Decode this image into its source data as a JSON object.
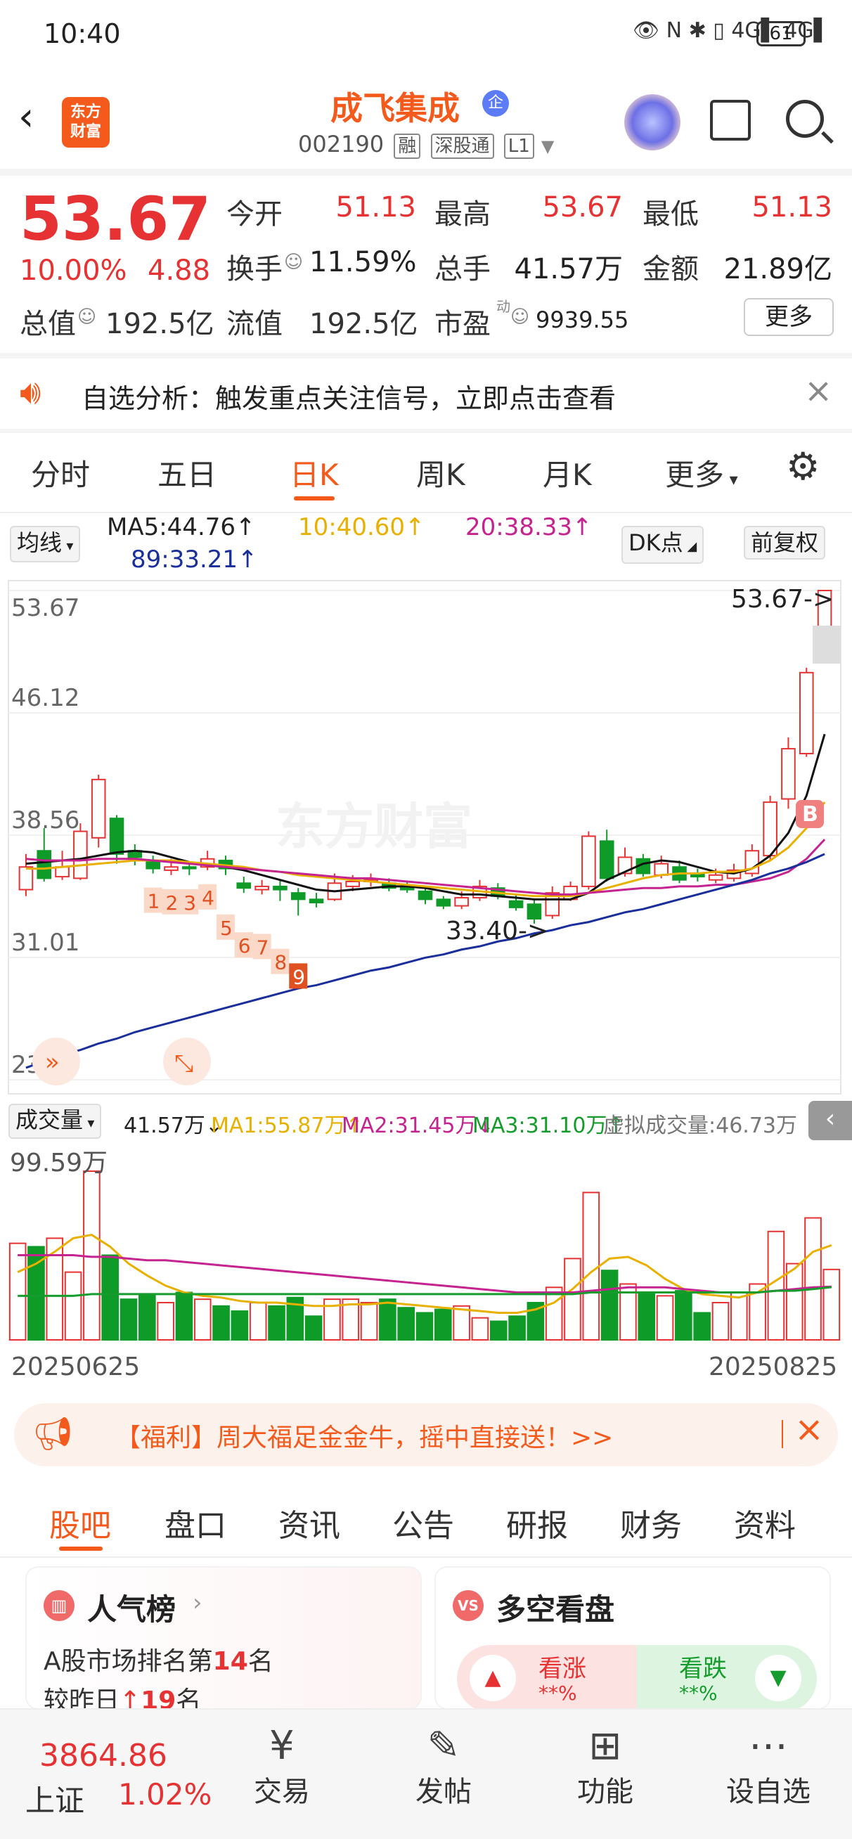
{
  "status": {
    "time": "10:40",
    "icons": "👁 N ✱   ▯ 4G▌ 4G▌",
    "battery": "61"
  },
  "header": {
    "logo": "东方\n财富",
    "title": "成飞集成",
    "qi_badge": "企",
    "code": "002190",
    "badges": [
      "融",
      "深股通",
      "L1"
    ]
  },
  "quote": {
    "price": "53.67",
    "pct": "10.00%",
    "change": "4.88",
    "stats": [
      {
        "label": "今开",
        "value": "51.13",
        "color": "#e63232"
      },
      {
        "label": "最高",
        "value": "53.67",
        "color": "#e63232"
      },
      {
        "label": "最低",
        "value": "51.13",
        "color": "#e63232"
      },
      {
        "label": "换手",
        "value": "11.59%",
        "color": "#222"
      },
      {
        "label": "总手",
        "value": "41.57万",
        "color": "#222"
      },
      {
        "label": "金额",
        "value": "21.89亿",
        "color": "#222"
      },
      {
        "label": "总值",
        "value": "192.5亿",
        "color": "#222"
      },
      {
        "label": "流值",
        "value": "192.5亿",
        "color": "#222"
      },
      {
        "label": "市盈",
        "value": "9939.55",
        "color": "#222"
      }
    ],
    "pe_sup": "动",
    "more": "更多"
  },
  "notice": {
    "text": "自选分析：触发重点关注信号，立即点击查看"
  },
  "tabs": [
    "分时",
    "五日",
    "日K",
    "周K",
    "月K",
    "更多"
  ],
  "ma": {
    "selector": "均线",
    "ma5": "MA5:44.76↑",
    "ma10": "10:40.60↑",
    "ma20": "20:38.33↑",
    "ma89": "89:33.21↑",
    "dk": "DK点",
    "fq": "前复权"
  },
  "kchart": {
    "y_labels": [
      "53.67",
      "46.12",
      "38.56",
      "31.01",
      "23.46"
    ],
    "high_note": "53.67->",
    "low_note": "33.40->",
    "seq_numbers": [
      "1",
      "2",
      "3",
      "4",
      "5",
      "6",
      "7",
      "8",
      "9"
    ],
    "watermark": "东方财富",
    "b_marker": "B"
  },
  "volume": {
    "selector": "成交量",
    "vol": "41.57万↓",
    "ma1": "MA1:55.87万↑",
    "ma2": "MA2:31.45万↓",
    "ma3": "MA3:31.10万↑",
    "virtual": "虚拟成交量:46.73万",
    "max_label": "99.59万",
    "date_start": "20250625",
    "date_end": "20250825"
  },
  "chart_data": {
    "type": "candlestick",
    "ylim": [
      23.46,
      53.67
    ],
    "candles": [
      {
        "o": 35.2,
        "c": 36.6,
        "h": 37.4,
        "l": 34.8
      },
      {
        "o": 37.6,
        "c": 35.9,
        "h": 39.0,
        "l": 35.7
      },
      {
        "o": 36.0,
        "c": 36.6,
        "h": 37.6,
        "l": 35.8
      },
      {
        "o": 35.9,
        "c": 38.8,
        "h": 39.3,
        "l": 35.8
      },
      {
        "o": 38.4,
        "c": 42.0,
        "h": 42.3,
        "l": 37.8
      },
      {
        "o": 39.6,
        "c": 37.4,
        "h": 39.8,
        "l": 36.8
      },
      {
        "o": 37.6,
        "c": 37.2,
        "h": 38.0,
        "l": 36.7
      },
      {
        "o": 36.9,
        "c": 36.5,
        "h": 37.3,
        "l": 36.2
      },
      {
        "o": 36.4,
        "c": 36.6,
        "h": 37.1,
        "l": 36.1
      },
      {
        "o": 36.6,
        "c": 36.5,
        "h": 36.9,
        "l": 36.1
      },
      {
        "o": 36.6,
        "c": 37.1,
        "h": 37.6,
        "l": 36.4
      },
      {
        "o": 37.0,
        "c": 36.5,
        "h": 37.3,
        "l": 36.1
      },
      {
        "o": 35.6,
        "c": 35.3,
        "h": 36.0,
        "l": 35.0
      },
      {
        "o": 35.2,
        "c": 35.4,
        "h": 35.8,
        "l": 34.9
      },
      {
        "o": 35.4,
        "c": 35.2,
        "h": 35.8,
        "l": 34.5
      },
      {
        "o": 35.0,
        "c": 34.6,
        "h": 35.3,
        "l": 33.6
      },
      {
        "o": 34.6,
        "c": 34.4,
        "h": 35.0,
        "l": 34.1
      },
      {
        "o": 34.6,
        "c": 35.6,
        "h": 36.2,
        "l": 34.5
      },
      {
        "o": 35.4,
        "c": 35.7,
        "h": 36.1,
        "l": 35.1
      },
      {
        "o": 35.7,
        "c": 35.8,
        "h": 36.2,
        "l": 35.4
      },
      {
        "o": 35.6,
        "c": 35.3,
        "h": 35.9,
        "l": 35.1
      },
      {
        "o": 35.3,
        "c": 35.2,
        "h": 35.7,
        "l": 35.0
      },
      {
        "o": 35.1,
        "c": 34.6,
        "h": 35.4,
        "l": 34.3
      },
      {
        "o": 34.6,
        "c": 34.2,
        "h": 34.8,
        "l": 34.0
      },
      {
        "o": 34.2,
        "c": 34.7,
        "h": 35.1,
        "l": 34.0
      },
      {
        "o": 34.7,
        "c": 35.4,
        "h": 35.8,
        "l": 34.5
      },
      {
        "o": 35.3,
        "c": 34.8,
        "h": 35.6,
        "l": 34.6
      },
      {
        "o": 34.5,
        "c": 34.1,
        "h": 34.9,
        "l": 33.9
      },
      {
        "o": 34.3,
        "c": 33.4,
        "h": 34.6,
        "l": 33.1
      },
      {
        "o": 33.6,
        "c": 35.0,
        "h": 35.4,
        "l": 33.4
      },
      {
        "o": 34.6,
        "c": 35.4,
        "h": 35.7,
        "l": 34.5
      },
      {
        "o": 35.4,
        "c": 38.5,
        "h": 38.8,
        "l": 35.2
      },
      {
        "o": 38.2,
        "c": 35.9,
        "h": 38.9,
        "l": 35.7
      },
      {
        "o": 36.2,
        "c": 37.2,
        "h": 37.8,
        "l": 36.0
      },
      {
        "o": 37.1,
        "c": 36.2,
        "h": 37.4,
        "l": 36.0
      },
      {
        "o": 36.1,
        "c": 36.8,
        "h": 37.3,
        "l": 35.9
      },
      {
        "o": 36.6,
        "c": 35.8,
        "h": 37.0,
        "l": 35.6
      },
      {
        "o": 36.2,
        "c": 36.0,
        "h": 36.5,
        "l": 35.7
      },
      {
        "o": 35.8,
        "c": 36.1,
        "h": 36.5,
        "l": 35.6
      },
      {
        "o": 35.9,
        "c": 36.4,
        "h": 36.8,
        "l": 35.7
      },
      {
        "o": 36.2,
        "c": 37.6,
        "h": 38.0,
        "l": 36.0
      },
      {
        "o": 37.3,
        "c": 40.6,
        "h": 41.0,
        "l": 37.0
      },
      {
        "o": 40.8,
        "c": 43.9,
        "h": 44.6,
        "l": 40.2
      },
      {
        "o": 43.6,
        "c": 48.6,
        "h": 48.9,
        "l": 43.4
      },
      {
        "o": 51.13,
        "c": 53.67,
        "h": 53.67,
        "l": 51.13
      }
    ],
    "ma_series": [
      {
        "name": "MA5",
        "values": [
          36.8,
          36.9,
          37.0,
          37.1,
          37.3,
          37.5,
          37.6,
          37.5,
          37.2,
          36.9,
          36.7,
          36.6,
          36.4,
          36.1,
          35.8,
          35.5,
          35.2,
          35.1,
          35.2,
          35.3,
          35.4,
          35.4,
          35.3,
          35.1,
          34.9,
          34.9,
          34.8,
          34.7,
          34.6,
          34.6,
          34.6,
          35.0,
          35.8,
          36.3,
          36.8,
          37.0,
          36.9,
          36.6,
          36.3,
          36.2,
          36.5,
          37.3,
          38.7,
          41.0,
          44.8
        ]
      },
      {
        "name": "MA10",
        "values": [
          36.5,
          36.5,
          36.6,
          36.7,
          36.8,
          36.9,
          37.0,
          37.0,
          37.0,
          36.9,
          36.8,
          36.7,
          36.6,
          36.4,
          36.3,
          36.1,
          36.0,
          35.9,
          35.8,
          35.7,
          35.6,
          35.5,
          35.4,
          35.3,
          35.2,
          35.1,
          35.0,
          34.9,
          34.8,
          34.8,
          34.8,
          35.0,
          35.3,
          35.6,
          35.9,
          36.1,
          36.2,
          36.2,
          36.3,
          36.3,
          36.5,
          37.0,
          37.8,
          39.0,
          40.6
        ]
      },
      {
        "name": "MA20",
        "values": [
          37.1,
          37.0,
          37.0,
          37.0,
          37.1,
          37.1,
          37.1,
          37.0,
          36.9,
          36.8,
          36.7,
          36.6,
          36.5,
          36.4,
          36.3,
          36.2,
          36.1,
          36.0,
          35.9,
          35.9,
          35.8,
          35.7,
          35.6,
          35.5,
          35.4,
          35.3,
          35.2,
          35.1,
          35.0,
          34.9,
          34.9,
          35.0,
          35.1,
          35.2,
          35.3,
          35.3,
          35.4,
          35.4,
          35.5,
          35.5,
          35.7,
          35.9,
          36.3,
          37.1,
          38.3
        ]
      },
      {
        "name": "MA89",
        "values": [
          24.2,
          24.6,
          25.0,
          25.3,
          25.7,
          26.0,
          26.4,
          26.7,
          27.0,
          27.3,
          27.6,
          27.9,
          28.2,
          28.5,
          28.8,
          29.1,
          29.3,
          29.6,
          29.9,
          30.2,
          30.4,
          30.7,
          31.0,
          31.2,
          31.5,
          31.7,
          32.0,
          32.2,
          32.5,
          32.7,
          33.0,
          33.2,
          33.5,
          33.8,
          34.0,
          34.3,
          34.6,
          34.9,
          35.2,
          35.5,
          35.8,
          36.2,
          36.5,
          36.9,
          37.4
        ]
      }
    ],
    "volume": [
      57,
      55,
      60,
      40,
      99.59,
      50,
      24,
      27,
      22,
      28,
      24,
      20,
      17,
      22,
      20,
      25,
      14,
      24,
      24,
      22,
      24,
      19,
      16,
      18,
      20,
      13,
      11,
      14,
      22,
      31,
      48,
      87,
      41,
      33,
      28,
      26,
      29,
      16,
      22,
      28,
      33,
      64,
      45,
      72,
      41.57
    ],
    "volume_ma": [
      {
        "name": "MA1",
        "values": [
          40,
          45,
          52,
          60,
          62,
          55,
          45,
          38,
          32,
          28,
          26,
          25,
          23,
          22,
          22,
          21,
          20,
          20,
          21,
          21,
          22,
          21,
          20,
          19,
          18,
          17,
          16,
          16,
          18,
          22,
          30,
          40,
          48,
          49,
          44,
          36,
          30,
          27,
          26,
          25,
          28,
          35,
          42,
          52,
          55.87
        ]
      },
      {
        "name": "MA2",
        "values": [
          50,
          50,
          50,
          50,
          49,
          49,
          48,
          47,
          47,
          46,
          45,
          44,
          43,
          42,
          41,
          40,
          39,
          38,
          37,
          36,
          35,
          34,
          33,
          32,
          31,
          30,
          29,
          28,
          28,
          28,
          28,
          29,
          30,
          31,
          31,
          31,
          30,
          29,
          28,
          28,
          28,
          29,
          30,
          31,
          31.45
        ]
      },
      {
        "name": "MA3",
        "values": [
          26,
          26,
          26,
          26,
          27,
          27,
          27,
          27,
          27,
          27,
          27,
          27,
          27,
          27,
          27,
          27,
          27,
          27,
          27,
          27,
          27,
          27,
          27,
          27,
          27,
          27,
          27,
          27,
          27,
          27,
          27,
          28,
          28,
          28,
          28,
          28,
          28,
          28,
          28,
          28,
          28,
          29,
          29,
          30,
          31.1
        ]
      }
    ]
  },
  "banner": {
    "text": "【福利】周大福足金金牛，摇中直接送！>>"
  },
  "subtabs": [
    "股吧",
    "盘口",
    "资讯",
    "公告",
    "研报",
    "财务",
    "资料"
  ],
  "cards": {
    "popularity": {
      "title": "人气榜",
      "line1": "A股市场排名第",
      "rank": "14",
      "line1_end": "名",
      "line2": "较昨日",
      "delta": "19",
      "line2_end": "名"
    },
    "bullbear": {
      "title": "多空看盘",
      "up": "看涨",
      "down": "看跌",
      "up_pct": "**%",
      "down_pct": "**%"
    }
  },
  "bottom": {
    "index_value": "3864.86",
    "index_name": "上证",
    "index_pct": "1.02%",
    "nav": [
      {
        "label": "交易",
        "icon": "¥"
      },
      {
        "label": "发帖",
        "icon": "✎"
      },
      {
        "label": "功能",
        "icon": "⊞"
      },
      {
        "label": "设自选",
        "icon": "⋯"
      }
    ]
  }
}
